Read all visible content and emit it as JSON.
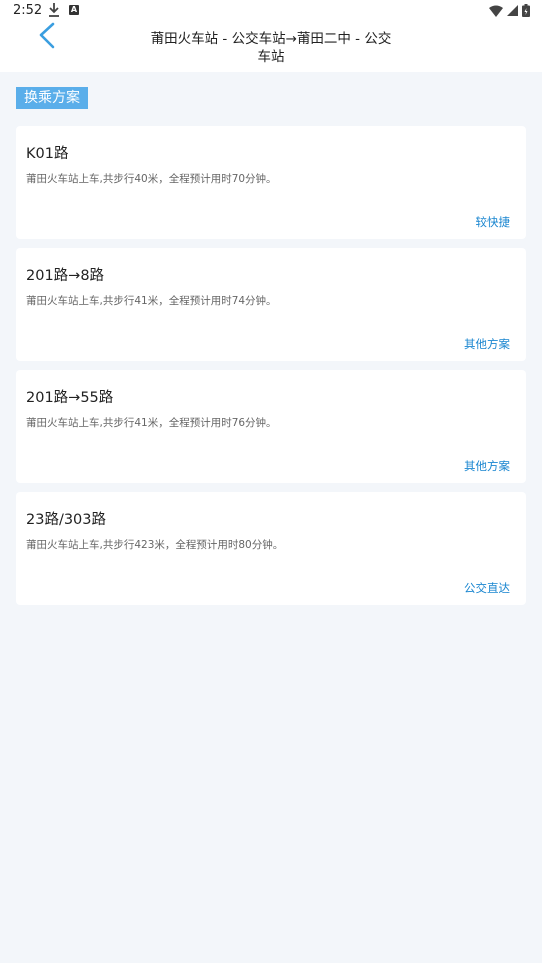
{
  "status": {
    "time": "2:52",
    "notif_letter": "A"
  },
  "header": {
    "title": "莆田火车站 - 公交车站→莆田二中 - 公交车站"
  },
  "section": {
    "label": "换乘方案"
  },
  "routes": [
    {
      "title": "K01路",
      "desc": "莆田火车站上车,共步行40米，全程预计用时70分钟。",
      "tag": "较快捷"
    },
    {
      "title": "201路→8路",
      "desc": "莆田火车站上车,共步行41米，全程预计用时74分钟。",
      "tag": "其他方案"
    },
    {
      "title": "201路→55路",
      "desc": "莆田火车站上车,共步行41米，全程预计用时76分钟。",
      "tag": "其他方案"
    },
    {
      "title": "23路/303路",
      "desc": "莆田火车站上车,共步行423米，全程预计用时80分钟。",
      "tag": "公交直达"
    }
  ],
  "colors": {
    "accent": "#1a86d0",
    "label_bg": "#5aaeea",
    "page_bg": "#f3f6fa"
  }
}
